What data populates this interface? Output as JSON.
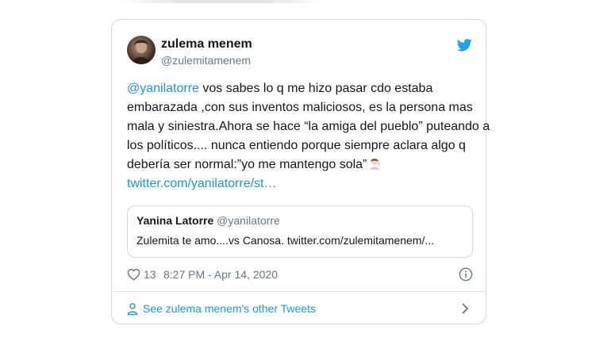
{
  "tweet": {
    "author": {
      "name": "zulema menem",
      "handle": "@zulemitamenem"
    },
    "text_lines": [
      {
        "mention": "@yanilatorre",
        "text": " vos sabes lo q me hizo pasar cdo estaba"
      },
      {
        "text": "embarazada ,con sus inventos maliciosos, es la persona mas"
      },
      {
        "text": "mala y siniestra.Ahora se hace “la amiga del pueblo” puteando a"
      },
      {
        "text": "los políticos.... nunca entiendo porque siempre aclara algo q"
      },
      {
        "text": "debería ser normal:”yo me mantengo sola”"
      }
    ],
    "emoji": "woman-raising-hand-emoji",
    "link": "twitter.com/yanilatorre/st…",
    "quote": {
      "name": "Yanina Latorre",
      "handle": "@yanilatorre",
      "text": "Zulemita te amo....vs Canosa. twitter.com/zulemitamenem/..."
    },
    "likes": "13",
    "timestamp": "8:27 PM - Apr 14, 2020",
    "see_more": "See zulema menem's other Tweets"
  },
  "icons": {
    "brand": "twitter-bird-icon",
    "like": "heart-icon",
    "info": "info-icon",
    "profile": "person-icon",
    "chevron": "chevron-right-icon"
  },
  "colors": {
    "accent": "#1b95e0",
    "text": "#14171a",
    "secondary": "#657786",
    "border": "#cfd9de"
  }
}
